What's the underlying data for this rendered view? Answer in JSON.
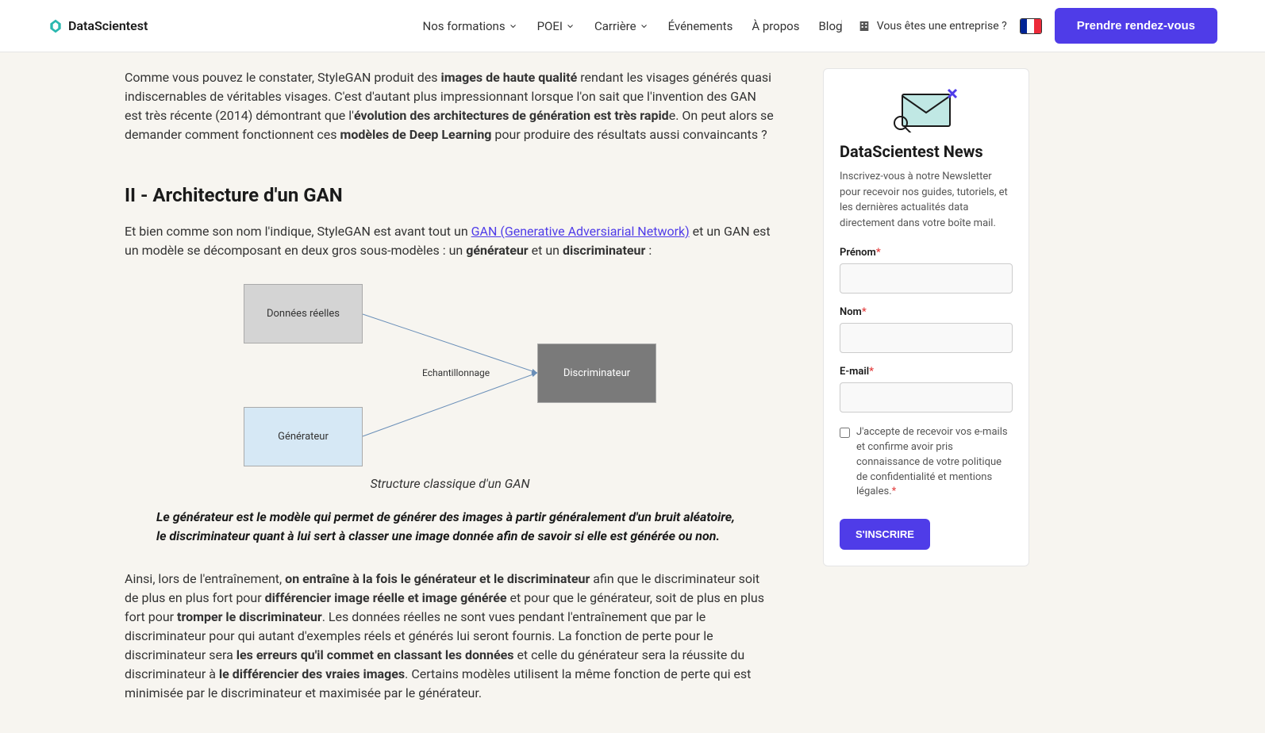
{
  "header": {
    "logo_text": "DataScientest",
    "nav": [
      {
        "label": "Nos formations",
        "dropdown": true
      },
      {
        "label": "POEI",
        "dropdown": true
      },
      {
        "label": "Carrière",
        "dropdown": true
      },
      {
        "label": "Événements",
        "dropdown": false
      },
      {
        "label": "À propos",
        "dropdown": false
      },
      {
        "label": "Blog",
        "dropdown": false
      }
    ],
    "enterprise": "Vous êtes une entreprise ?",
    "cta": "Prendre rendez-vous"
  },
  "content": {
    "p1_a": "Comme vous pouvez le constater, StyleGAN produit des ",
    "p1_b1": "images de haute qualité",
    "p1_c": " rendant les visages générés quasi indiscernables de véritables visages. C'est d'autant plus impressionnant lorsque l'on sait que l'invention des GAN est très récente (2014) démontrant que l'",
    "p1_b2": "évolution des architectures de génération est très rapid",
    "p1_d": "e. On peut alors se demander comment fonctionnent ces ",
    "p1_b3": "modèles de Deep Learning",
    "p1_e": " pour produire des résultats aussi convaincants ?",
    "h2": "II - Architecture d'un GAN",
    "p2_a": "Et bien comme son nom l'indique, StyleGAN est avant tout un ",
    "p2_link": "GAN (Generative Adversiarial Network)",
    "p2_b": " et un GAN est un modèle se décomposant en deux gros sous-modèles : un ",
    "p2_b1": "générateur",
    "p2_c": " et un ",
    "p2_b2": "discriminateur",
    "p2_d": " :",
    "diagram": {
      "data": "Données réelles",
      "gen": "Générateur",
      "disc": "Discriminateur",
      "sampling": "Echantillonnage"
    },
    "caption": "Structure classique d'un GAN",
    "quote": "Le générateur est le modèle qui permet de générer des images à partir généralement d'un bruit aléatoire, le discriminateur quant à lui sert à classer une image donnée afin de savoir si elle est générée ou non.",
    "p3_a": "Ainsi, lors de l'entraînement, ",
    "p3_b1": "on entraîne à la fois le générateur et le discriminateur",
    "p3_b": " afin que le discriminateur soit de plus en plus fort pour ",
    "p3_b2": "différencier image réelle et image générée",
    "p3_c": " et pour que le générateur, soit de plus en plus fort pour ",
    "p3_b3": "tromper le discriminateur",
    "p3_d": ". Les données réelles ne sont vues pendant l'entraînement que par le discriminateur pour qui autant d'exemples réels et générés lui seront fournis. La fonction de perte pour le discriminateur sera ",
    "p3_b4": "les erreurs qu'il commet en classant les données",
    "p3_e": " et celle du générateur sera la réussite du discriminateur à ",
    "p3_b5": "le différencier des vraies images",
    "p3_f": ". Certains modèles utilisent la même fonction de perte qui est minimisée par le discriminateur et maximisée par le générateur."
  },
  "sidebar": {
    "title": "DataScientest News",
    "desc": "Inscrivez-vous à notre Newsletter pour recevoir nos guides, tutoriels, et les dernières actualités data directement dans votre boîte mail.",
    "fields": {
      "firstname": "Prénom",
      "lastname": "Nom",
      "email": "E-mail"
    },
    "consent": "J'accepte de recevoir vos e-mails et confirme avoir pris connaissance de votre politique de confidentialité et mentions légales.",
    "submit": "S'INSCRIRE"
  }
}
